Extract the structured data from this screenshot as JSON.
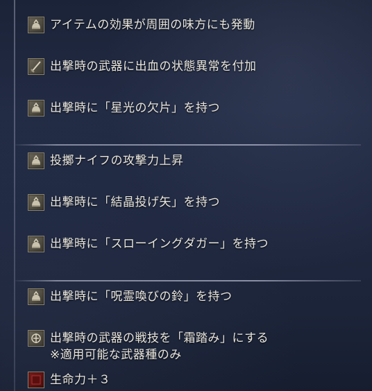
{
  "effects": [
    {
      "icon": "item-icon",
      "line1": "アイテムの効果が周囲の味方にも発動"
    },
    {
      "icon": "weapon-icon",
      "line1": "出撃時の武器に出血の状態異常を付加"
    },
    {
      "icon": "item-icon",
      "line1": "出撃時に「星光の欠片」を持つ"
    },
    {
      "icon": "item-icon",
      "line1": "投擲ナイフの攻撃力上昇"
    },
    {
      "icon": "item-icon",
      "line1": "出撃時に「結晶投げ矢」を持つ"
    },
    {
      "icon": "item-icon",
      "line1": "出撃時に「スローイングダガー」を持つ"
    },
    {
      "icon": "item-icon",
      "line1": "出撃時に「呪霊喚びの鈴」を持つ"
    },
    {
      "icon": "skill-icon",
      "line1": "出撃時の武器の戦技を「霜踏み」にする",
      "line2": "※適用可能な武器種のみ"
    },
    {
      "icon": "vigor-icon",
      "line1": "生命力＋３"
    }
  ]
}
